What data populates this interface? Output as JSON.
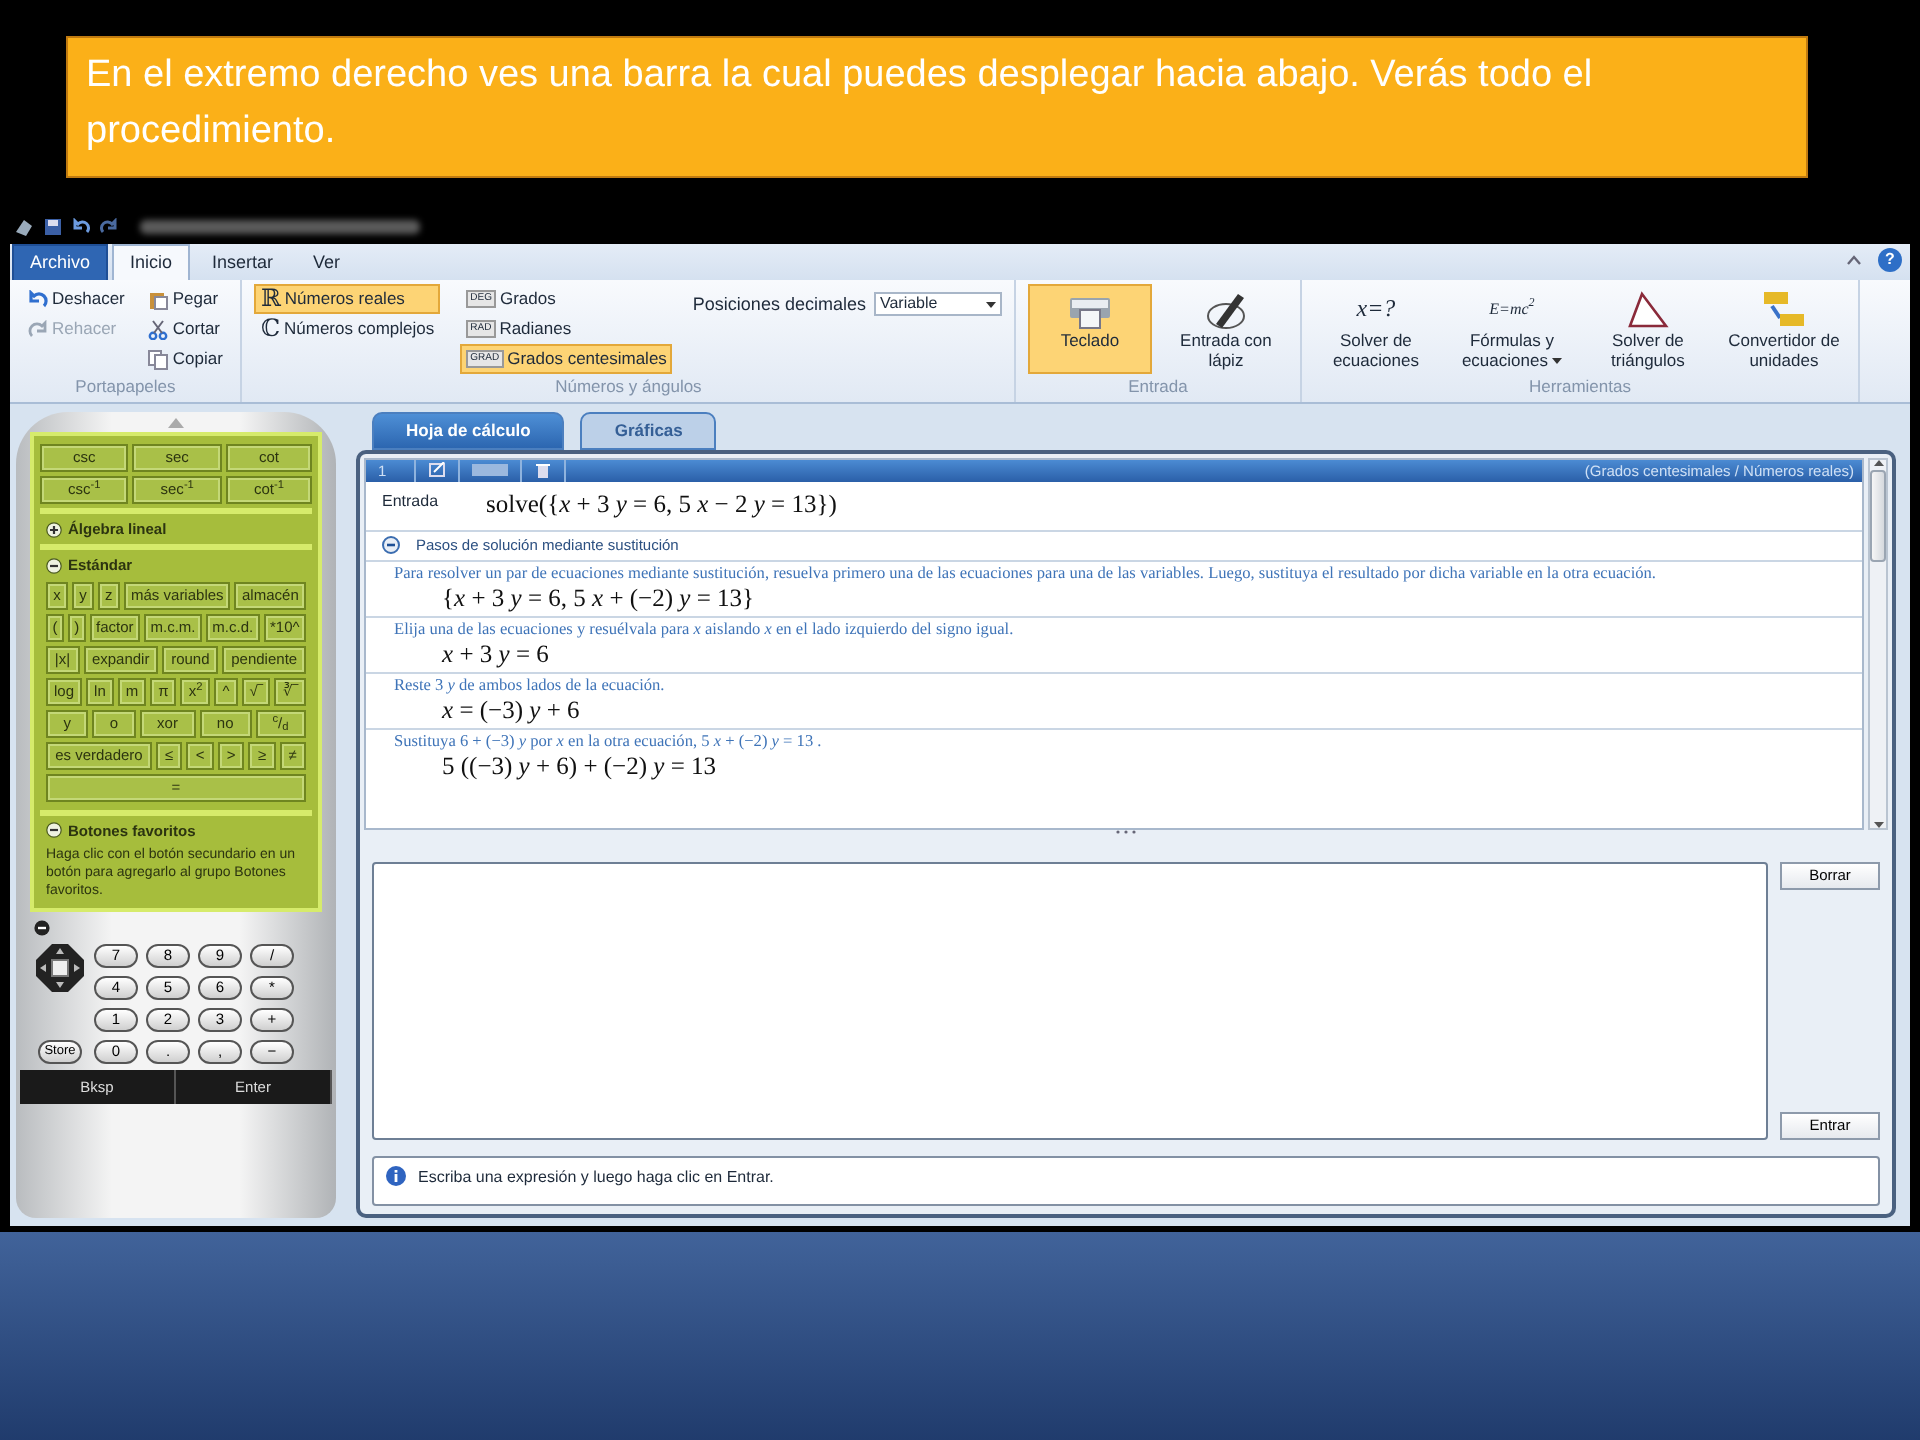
{
  "callout": {
    "text": "En el extremo derecho ves una barra la cual puedes desplegar hacia abajo. Verás todo el procedimiento."
  },
  "ribbon": {
    "tabs": [
      {
        "label": "Archivo",
        "kind": "file",
        "selected": false
      },
      {
        "label": "Inicio",
        "kind": "tab",
        "selected": true
      },
      {
        "label": "Insertar",
        "kind": "tab",
        "selected": false
      },
      {
        "label": "Ver",
        "kind": "tab",
        "selected": false
      }
    ],
    "help": "?",
    "groups": [
      {
        "kind": "clipboard",
        "title": "Portapapeles",
        "items": [
          {
            "kind": "undo",
            "label": "Deshacer",
            "disabled": false
          },
          {
            "kind": "redo",
            "label": "Rehacer",
            "disabled": true
          },
          {
            "kind": "paste",
            "label": "Pegar",
            "disabled": false
          },
          {
            "kind": "cut",
            "label": "Cortar",
            "disabled": false
          },
          {
            "kind": "copy",
            "label": "Copiar",
            "disabled": false
          }
        ]
      },
      {
        "kind": "numbers",
        "title": "Números y ángulos",
        "systems": [
          {
            "symbol": "ℝ",
            "label": "Números reales",
            "selected": true
          },
          {
            "symbol": "ℂ",
            "label": "Números complejos",
            "selected": false
          }
        ],
        "angles": [
          {
            "badge": "DEG",
            "label": "Grados",
            "selected": false
          },
          {
            "badge": "RAD",
            "label": "Radianes",
            "selected": false
          },
          {
            "badge": "GRAD",
            "label": "Grados centesimales",
            "selected": true
          }
        ],
        "decimals": {
          "label": "Posiciones decimales",
          "value": "Variable"
        }
      },
      {
        "kind": "input",
        "title": "Entrada",
        "items": [
          {
            "kind": "keyboard",
            "label": "Teclado",
            "selected": true
          },
          {
            "kind": "pen",
            "label": "Entrada con lápiz",
            "selected": false
          }
        ]
      },
      {
        "kind": "tools",
        "title": "Herramientas",
        "items": [
          {
            "kind": "solver",
            "icon_text": "x=?",
            "label": "Solver de ecuaciones"
          },
          {
            "kind": "formulas",
            "icon_text": "E=mc$^{2}$",
            "label": "Fórmulas y ecuaciones",
            "dropdown": true
          },
          {
            "kind": "triangle",
            "label": "Solver de triángulos"
          },
          {
            "kind": "units",
            "label": "Convertidor de unidades"
          }
        ]
      }
    ]
  },
  "calculator": {
    "trig": [
      [
        "csc",
        "sec",
        "cot"
      ],
      [
        "csc$^{-1}$",
        "sec$^{-1}$",
        "cot$^{-1}$"
      ]
    ],
    "sections": [
      {
        "title": "Álgebra lineal",
        "expanded": false
      },
      {
        "title": "Estándar",
        "expanded": true,
        "rows": [
          [
            "x",
            "y",
            "z",
            "más variables",
            "almacén"
          ],
          [
            "(",
            ")",
            "factor",
            "m.c.m.",
            "m.c.d.",
            "*10^"
          ],
          [
            "|x|",
            "expandir",
            "round",
            "pendiente"
          ],
          [
            "log",
            "ln",
            "m",
            "π",
            "x$^{2}$",
            "^",
            "√‾",
            "∛‾"
          ],
          [
            "y",
            "o",
            "xor",
            "no",
            "$^{c}$/$_{d}$"
          ],
          [
            "es verdadero",
            "≤",
            "<",
            ">",
            "≥",
            "≠"
          ],
          [
            "="
          ]
        ]
      },
      {
        "title": "Botones favoritos",
        "expanded": true,
        "text": "Haga clic con el botón secundario en un botón para agregarlo al grupo Botones favoritos."
      }
    ],
    "keypad": {
      "rows": [
        [
          "7",
          "8",
          "9",
          "/"
        ],
        [
          "4",
          "5",
          "6",
          "*"
        ],
        [
          "1",
          "2",
          "3",
          "+"
        ],
        [
          "0",
          ".",
          ",",
          "−"
        ]
      ],
      "store": "Store",
      "bottom": [
        "Bksp",
        "Enter"
      ]
    }
  },
  "worksheet": {
    "tabs": [
      {
        "label": "Hoja de cálculo",
        "selected": true
      },
      {
        "label": "Gráficas",
        "selected": false
      }
    ],
    "entry_number": "1",
    "mode": "(Grados centesimales / Números reales)",
    "entry": {
      "label": "Entrada",
      "expression": "solve({*x* + 3 *y* = 6, 5 *x* − 2 *y* = 13})"
    },
    "steps": {
      "title": "Pasos de solución mediante sustitución",
      "expanded": true,
      "items": [
        {
          "text": "Para resolver un par de ecuaciones mediante sustitución, resuelva primero una de las ecuaciones para una de las variables. Luego, sustituya el resultado por dicha variable en la otra ecuación.",
          "math": "{*x* + 3 *y* = 6, 5 *x* + (−2) *y* = 13}"
        },
        {
          "text": "Elija una de las ecuaciones y resuélvala para *x* aislando *x* en el lado izquierdo del signo igual.",
          "math": "*x* + 3 *y* = 6"
        },
        {
          "text": "Reste 3 *y* de ambos lados de la ecuación.",
          "math": "*x* = (−3) *y* + 6"
        },
        {
          "text": "Sustituya 6 + (−3) *y* por *x* en la otra ecuación, 5 *x* + (−2) *y* = 13 .",
          "math": "5 ((−3) *y* + 6) + (−2) *y* = 13"
        }
      ]
    },
    "input": {
      "buttons": [
        "Borrar",
        "Entrar"
      ]
    },
    "status": "Escriba una expresión y luego haga clic en Entrar."
  }
}
